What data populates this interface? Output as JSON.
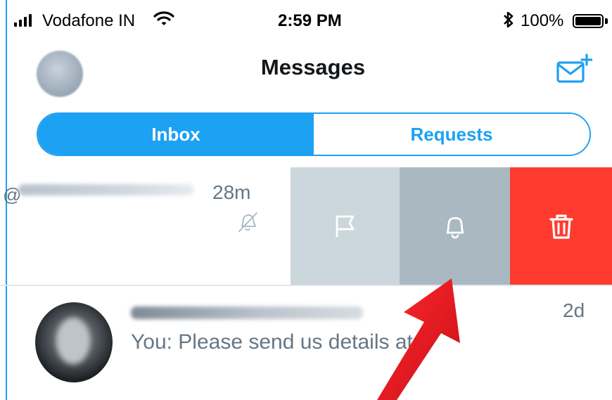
{
  "status_bar": {
    "carrier": "Vodafone IN",
    "time": "2:59 PM",
    "battery_pct": "100%",
    "battery_level": 1.0
  },
  "header": {
    "title": "Messages",
    "compose_icon": "compose-mail-icon"
  },
  "tabs": [
    {
      "label": "Inbox",
      "selected": true
    },
    {
      "label": "Requests",
      "selected": false
    }
  ],
  "conversations": [
    {
      "handle_prefix": "@",
      "time": "28m",
      "muted": true,
      "swipe_actions": [
        {
          "icon": "flag-icon",
          "color": "#ccd6dd"
        },
        {
          "icon": "bell-icon",
          "color": "#aab8c2"
        },
        {
          "icon": "trash-icon",
          "color": "#ff3b30"
        }
      ]
    },
    {
      "time": "2d",
      "preview": "You: Please send us details at"
    }
  ],
  "colors": {
    "accent": "#1da1f2",
    "delete": "#ff3b30",
    "secondary_text": "#657786",
    "annotation_arrow": "#e0141c"
  }
}
